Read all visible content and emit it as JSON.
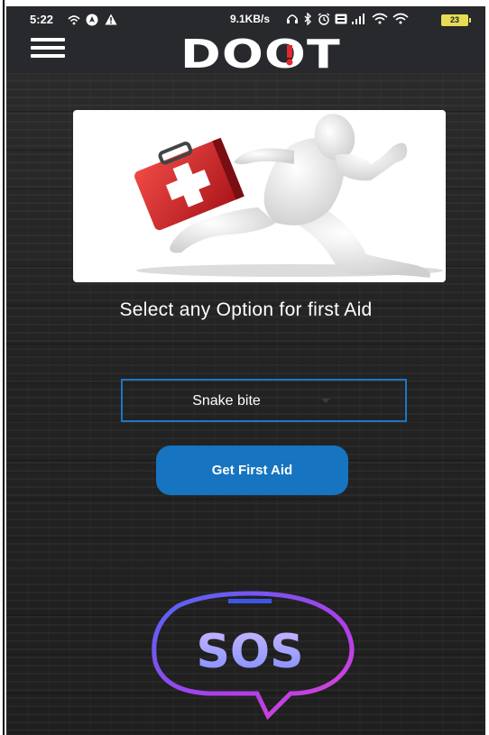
{
  "status_bar": {
    "time": "5:22",
    "net_speed": "9.1KB/s",
    "battery": "23"
  },
  "header": {
    "logo_text": "DOOT",
    "menu_icon": "hamburger-menu-icon"
  },
  "main": {
    "prompt": "Select any Option for first Aid",
    "dropdown": {
      "selected": "Snake bite"
    },
    "get_aid_button": "Get First Aid",
    "sos_label": "SOS"
  },
  "colors": {
    "accent_blue": "#1674c0",
    "header_bg": "#27292d",
    "logo_red": "#e3282f",
    "sos_purple": "#b63ff5"
  }
}
